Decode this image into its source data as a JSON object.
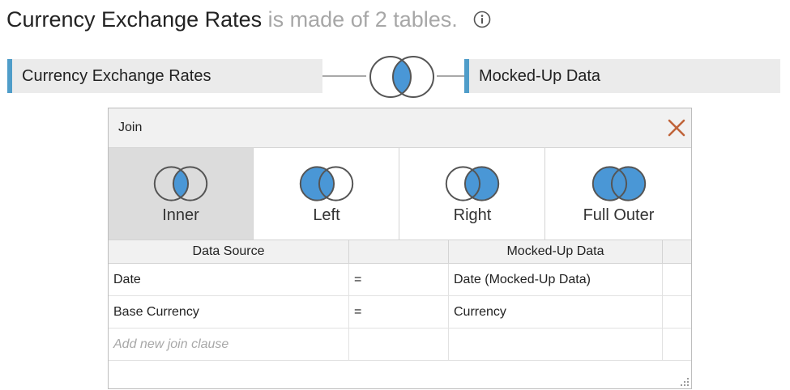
{
  "heading": {
    "title": "Currency Exchange Rates",
    "suffix": " is made of 2 tables.",
    "info_icon": "info-circle-icon"
  },
  "tables": {
    "left": "Currency Exchange Rates",
    "right": "Mocked-Up Data",
    "join_icon": "inner-join-venn-icon"
  },
  "dialog": {
    "title": "Join",
    "close_icon": "close-icon",
    "join_types": [
      {
        "label": "Inner",
        "icon": "inner-join-icon",
        "selected": true
      },
      {
        "label": "Left",
        "icon": "left-join-icon",
        "selected": false
      },
      {
        "label": "Right",
        "icon": "right-join-icon",
        "selected": false
      },
      {
        "label": "Full Outer",
        "icon": "full-outer-join-icon",
        "selected": false
      }
    ],
    "columns": {
      "left": "Data Source",
      "operator": "",
      "right": "Mocked-Up Data"
    },
    "clauses": [
      {
        "left": "Date",
        "op": "=",
        "right": "Date (Mocked-Up Data)"
      },
      {
        "left": "Base Currency",
        "op": "=",
        "right": "Currency"
      }
    ],
    "add_clause_placeholder": "Add new join clause"
  },
  "colors": {
    "accent": "#4a97d6",
    "selected_bg": "#dcdcdc",
    "close": "#c0643a",
    "pill_bar": "#4f9dc9"
  }
}
